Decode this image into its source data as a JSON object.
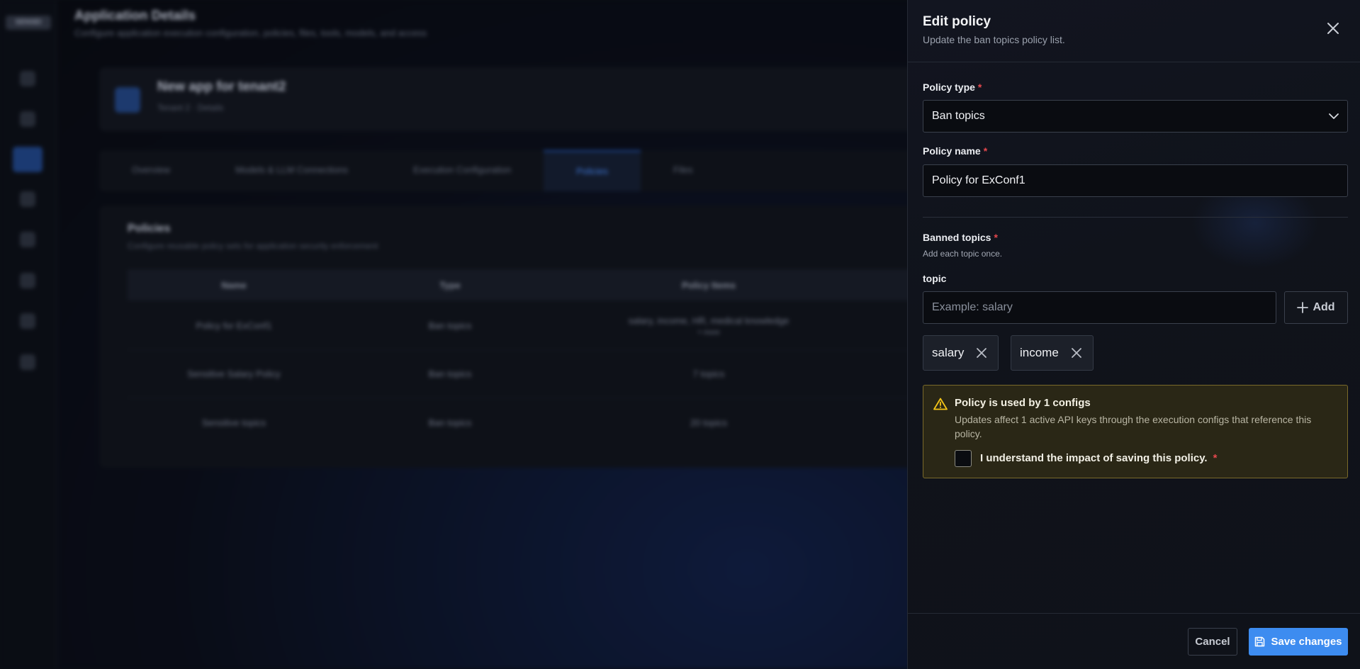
{
  "background": {
    "brand": "SENSEI",
    "page_title": "Application Details",
    "page_subtitle": "Configure application execution configuration, policies, files, tools, models, and access",
    "app": {
      "name": "New app for tenant2",
      "meta": "Tenant 2 · Details"
    },
    "tabs": [
      {
        "label": "Overview"
      },
      {
        "label": "Models & LLM Connections"
      },
      {
        "label": "Execution Configuration"
      },
      {
        "label": "Policies"
      },
      {
        "label": "Files"
      }
    ],
    "policies": {
      "title": "Policies",
      "subtitle": "Configure reusable policy sets for application security enforcement",
      "columns": [
        "Name",
        "Type",
        "Policy Items"
      ],
      "rows": [
        {
          "name": "Policy for ExConf1",
          "type": "Ban topics",
          "items": "salary, income, HR, medical knowledge",
          "items_extra": "+ more"
        },
        {
          "name": "Sensitive Salary Policy",
          "type": "Ban topics",
          "items": "7 topics",
          "items_extra": ""
        },
        {
          "name": "Sensitive topics",
          "type": "Ban topics",
          "items": "20 topics",
          "items_extra": ""
        }
      ]
    }
  },
  "drawer": {
    "title": "Edit policy",
    "subtitle": "Update the ban topics policy list.",
    "policy_type": {
      "label": "Policy type",
      "value": "Ban topics"
    },
    "policy_name": {
      "label": "Policy name",
      "value": "Policy for ExConf1"
    },
    "banned_topics": {
      "label": "Banned topics",
      "helper": "Add each topic once.",
      "topic_label": "topic",
      "placeholder": "Example: salary",
      "add_label": "Add",
      "chips": [
        {
          "label": "salary"
        },
        {
          "label": "income"
        }
      ]
    },
    "warning": {
      "title": "Policy is used by 1 configs",
      "text": "Updates affect 1 active API keys through the execution configs that reference this policy.",
      "checkbox_label": "I understand the impact of saving this policy."
    },
    "footer": {
      "cancel_label": "Cancel",
      "save_label": "Save changes"
    },
    "required_mark": "*"
  },
  "colors": {
    "accent": "#3d8cf0",
    "required": "#e5484d",
    "warning_border": "#7a6a2a",
    "warning_bg": "#2a2716",
    "warning_icon": "#f5c518"
  }
}
